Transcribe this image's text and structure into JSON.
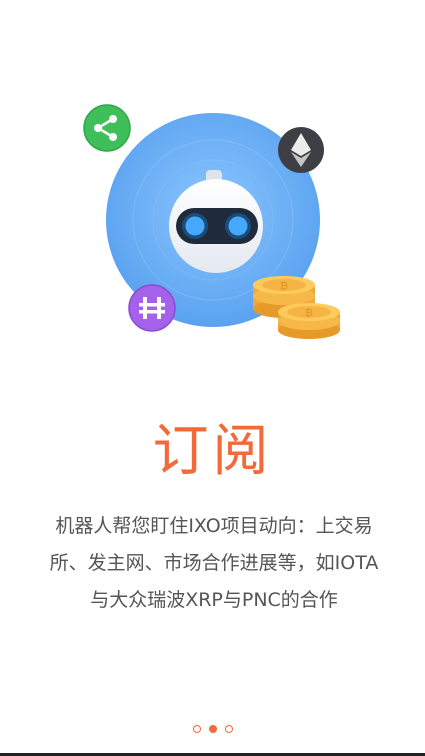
{
  "onboarding": {
    "title": "订阅",
    "description": "机器人帮您盯住IXO项目动向：上交易所、发主网、市场合作进展等，如IOTA与大众瑞波XRP与PNC的合作",
    "page_index": 2,
    "page_count": 3
  },
  "illustration": {
    "icons": [
      "robot-icon",
      "ripple-coin-icon",
      "ethereum-coin-icon",
      "hcash-coin-icon",
      "bitcoin-coin-stack-icon"
    ]
  },
  "colors": {
    "accent": "#f26a3a",
    "circle": "#69aef5",
    "text": "#555555"
  }
}
